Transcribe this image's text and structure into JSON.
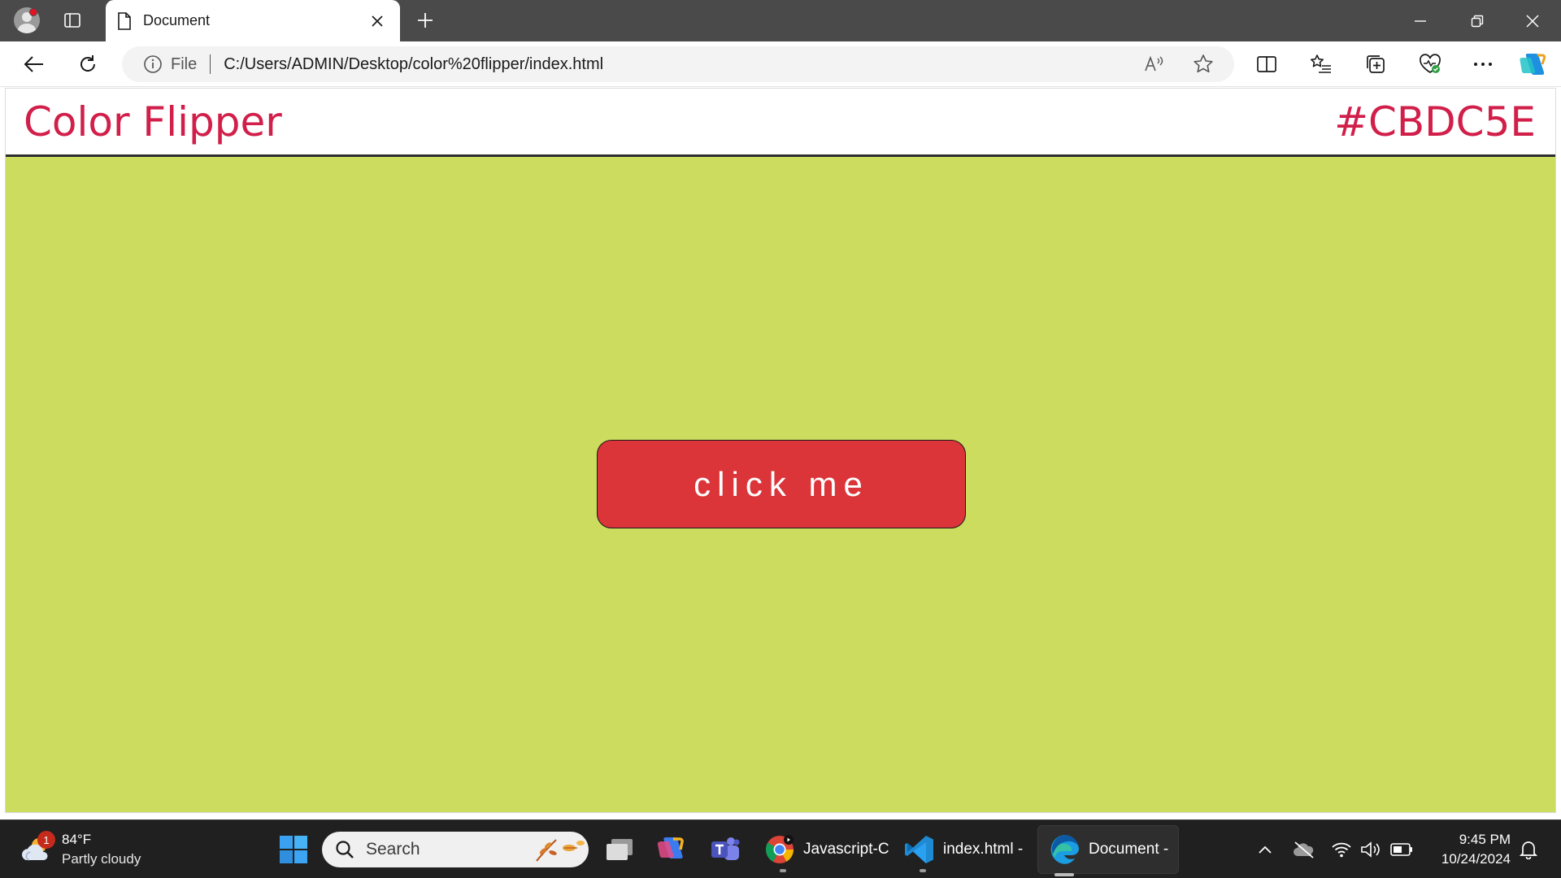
{
  "browser": {
    "tab_title": "Document",
    "omnibox": {
      "scheme_label": "File",
      "url": "C:/Users/ADMIN/Desktop/color%20flipper/index.html"
    }
  },
  "page": {
    "brand": "Color Flipper",
    "hex_value": "#CBDC5E",
    "button_label": "click me",
    "colors": {
      "background": "#cbdc5e",
      "accent": "#d11f4a",
      "button": "#db3439"
    }
  },
  "taskbar": {
    "weather": {
      "badge": "1",
      "temp": "84°F",
      "desc": "Partly cloudy"
    },
    "search_label": "Search",
    "apps": [
      {
        "label": "Javascript-C"
      },
      {
        "label": "index.html -"
      },
      {
        "label": "Document -"
      }
    ],
    "clock": {
      "time": "9:45 PM",
      "date": "10/24/2024"
    }
  }
}
